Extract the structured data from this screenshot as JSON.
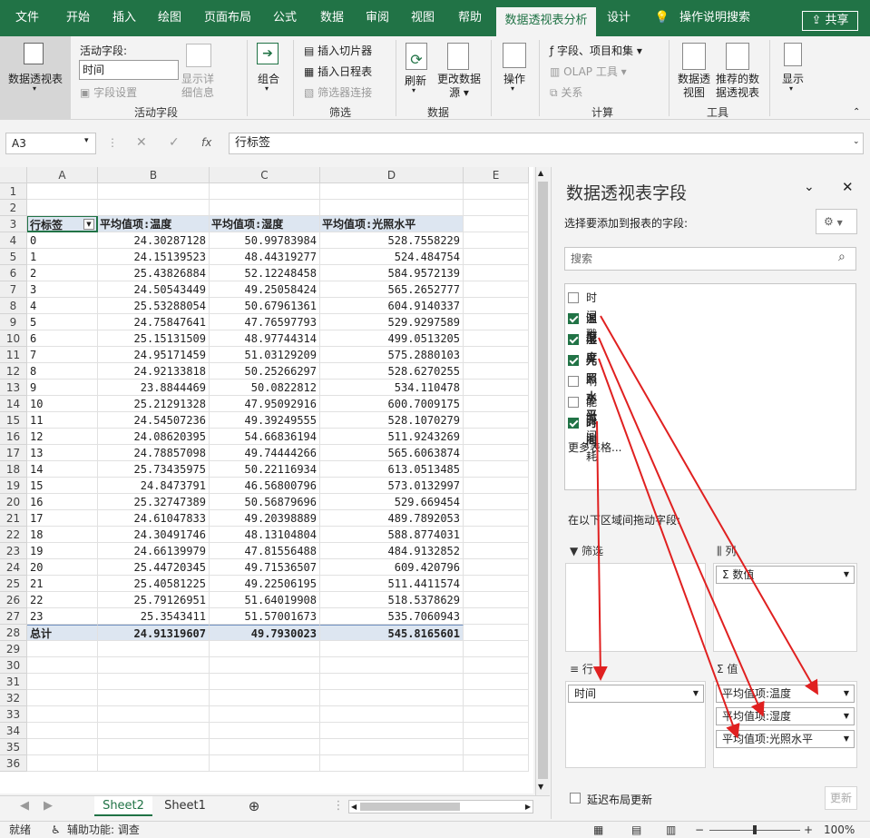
{
  "menu": {
    "tabs": [
      "文件",
      "开始",
      "插入",
      "绘图",
      "页面布局",
      "公式",
      "数据",
      "审阅",
      "视图",
      "帮助",
      "数据透视表分析",
      "设计",
      "操作说明搜索"
    ],
    "active": "数据透视表分析",
    "share": "共享"
  },
  "ribbon": {
    "pivot_table": "数据透视表",
    "active_field_label": "活动字段:",
    "active_field_value": "时间",
    "field_settings": "字段设置",
    "show_detail": "显示详细信息",
    "active_field_group": "活动字段",
    "group_btn": "组合",
    "insert_slicer": "插入切片器",
    "insert_timeline": "插入日程表",
    "filter_connection": "筛选器连接",
    "filter_group": "筛选",
    "refresh": "刷新",
    "change_source": "更改数据源",
    "data_group": "数据",
    "actions": "操作",
    "fields_items_sets": "字段、项目和集",
    "olap_tools": "OLAP 工具",
    "relationships": "关系",
    "calc_group": "计算",
    "pivot_chart": "数据透视图",
    "recommended": "推荐的数据透视表",
    "tools_group": "工具",
    "show": "显示"
  },
  "formula_bar": {
    "name_box": "A3",
    "fx": "fx",
    "content": "行标签"
  },
  "sheet": {
    "columns": [
      "A",
      "B",
      "C",
      "D",
      "E"
    ],
    "rows": [
      "1",
      "2",
      "3",
      "4",
      "5",
      "6",
      "7",
      "8",
      "9",
      "10",
      "11",
      "12",
      "13",
      "14",
      "15",
      "16",
      "17",
      "18",
      "19",
      "20",
      "21",
      "22",
      "23",
      "24",
      "25",
      "26",
      "27",
      "28",
      "29",
      "30",
      "31",
      "32",
      "33",
      "34",
      "35",
      "36"
    ],
    "headers": [
      "行标签",
      "平均值项:温度",
      "平均值项:湿度",
      "平均值项:光照水平"
    ],
    "data": [
      [
        "0",
        "24.30287128",
        "50.99783984",
        "528.7558229"
      ],
      [
        "1",
        "24.15139523",
        "48.44319277",
        "524.484754"
      ],
      [
        "2",
        "25.43826884",
        "52.12248458",
        "584.9572139"
      ],
      [
        "3",
        "24.50543449",
        "49.25058424",
        "565.2652777"
      ],
      [
        "4",
        "25.53288054",
        "50.67961361",
        "604.9140337"
      ],
      [
        "5",
        "24.75847641",
        "47.76597793",
        "529.9297589"
      ],
      [
        "6",
        "25.15131509",
        "48.97744314",
        "499.0513205"
      ],
      [
        "7",
        "24.95171459",
        "51.03129209",
        "575.2880103"
      ],
      [
        "8",
        "24.92133818",
        "50.25266297",
        "528.6270255"
      ],
      [
        "9",
        "23.8844469",
        "50.0822812",
        "534.110478"
      ],
      [
        "10",
        "25.21291328",
        "47.95092916",
        "600.7009175"
      ],
      [
        "11",
        "24.54507236",
        "49.39249555",
        "528.1070279"
      ],
      [
        "12",
        "24.08620395",
        "54.66836194",
        "511.9243269"
      ],
      [
        "13",
        "24.78857098",
        "49.74444266",
        "565.6063874"
      ],
      [
        "14",
        "25.73435975",
        "50.22116934",
        "613.0513485"
      ],
      [
        "15",
        "24.8473791",
        "46.56800796",
        "573.0132997"
      ],
      [
        "16",
        "25.32747389",
        "50.56879696",
        "529.669454"
      ],
      [
        "17",
        "24.61047833",
        "49.20398889",
        "489.7892053"
      ],
      [
        "18",
        "24.30491746",
        "48.13104804",
        "588.8774031"
      ],
      [
        "19",
        "24.66139979",
        "47.81556488",
        "484.9132852"
      ],
      [
        "20",
        "25.44720345",
        "49.71536507",
        "609.420796"
      ],
      [
        "21",
        "25.40581225",
        "49.22506195",
        "511.4411574"
      ],
      [
        "22",
        "25.79126951",
        "51.64019908",
        "518.5378629"
      ],
      [
        "23",
        "25.3543411",
        "51.57001673",
        "535.7060943"
      ]
    ],
    "total": [
      "总计",
      "24.91319607",
      "49.7930023",
      "545.8165601"
    ]
  },
  "sheet_tabs": [
    "Sheet2",
    "Sheet1"
  ],
  "active_sheet": "Sheet2",
  "status": {
    "ready": "就绪",
    "accessibility": "辅助功能: 调查",
    "zoom": "100%"
  },
  "pane": {
    "title": "数据透视表字段",
    "choose_label": "选择要添加到报表的字段:",
    "search_placeholder": "搜索",
    "fields": [
      {
        "name": "时间戳",
        "checked": false
      },
      {
        "name": "温度",
        "checked": true
      },
      {
        "name": "湿度",
        "checked": true
      },
      {
        "name": "光照水平",
        "checked": true
      },
      {
        "name": "响应时间",
        "checked": false
      },
      {
        "name": "能源消耗",
        "checked": false
      },
      {
        "name": "时间",
        "checked": true
      }
    ],
    "more_tables": "更多表格...",
    "drag_label": "在以下区域间拖动字段:",
    "filter_zone": "筛选",
    "column_zone": "列",
    "row_zone": "行",
    "value_zone": "值",
    "column_chips": [
      "Σ 数值"
    ],
    "row_chips": [
      "时间"
    ],
    "value_chips": [
      "平均值项:温度",
      "平均值项:湿度",
      "平均值项:光照水平"
    ],
    "defer_update": "延迟布局更新",
    "update_btn": "更新"
  },
  "colors": {
    "accent": "#217346",
    "arrow": "#e02020",
    "pivot_header": "#dde6f1"
  }
}
